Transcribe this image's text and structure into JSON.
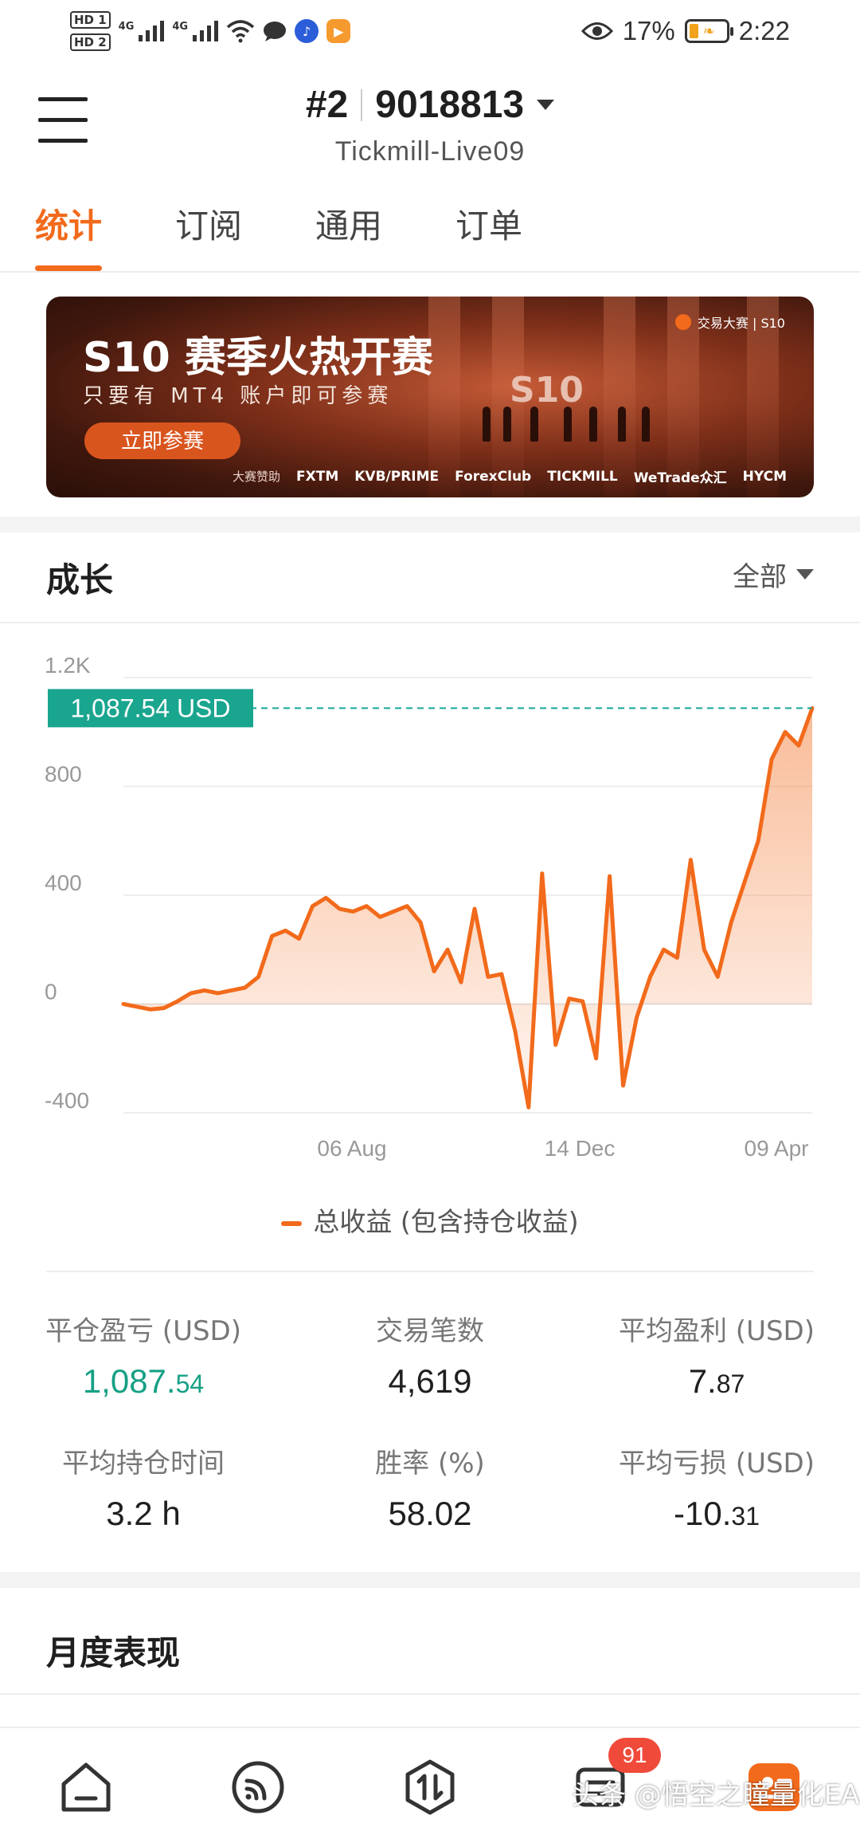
{
  "status_bar": {
    "hd1": "HD 1",
    "hd2": "HD 2",
    "net1": "4G",
    "net2": "4G",
    "battery_pct": "17%",
    "time": "2:22"
  },
  "header": {
    "account_number": "#2",
    "account_id": "9018813",
    "server": "Tickmill-Live09"
  },
  "tabs": [
    {
      "label": "统计",
      "active": true
    },
    {
      "label": "订阅",
      "active": false
    },
    {
      "label": "通用",
      "active": false
    },
    {
      "label": "订单",
      "active": false
    }
  ],
  "banner": {
    "title": "S10 赛季火热开赛",
    "subtitle": "只要有 MT4 账户即可参赛",
    "button": "立即参赛",
    "tag": "交易大赛 | S10",
    "emblem": "S10",
    "sponsor_lead": "大赛赞助",
    "sponsors": [
      "FXTM",
      "KVB/PRIME",
      "ForexClub",
      "TICKMILL",
      "WeTrade众汇",
      "HYCM"
    ]
  },
  "growth": {
    "title": "成长",
    "range": "全部"
  },
  "chart_data": {
    "type": "area",
    "ylim": [
      -400,
      1200
    ],
    "y_ticks": [
      "1.2K",
      "800",
      "400",
      "0",
      "-400"
    ],
    "x_tick_labels": [
      "06 Aug",
      "14 Dec",
      "09 Apr"
    ],
    "current_value_label": "1,087.54 USD",
    "current_value": 1087.54,
    "series": [
      {
        "name": "总收益 (包含持仓收益)",
        "color": "#f26a1b",
        "values": [
          0,
          -10,
          -20,
          -15,
          10,
          40,
          50,
          40,
          50,
          60,
          100,
          250,
          270,
          240,
          360,
          390,
          350,
          340,
          360,
          320,
          340,
          360,
          300,
          120,
          200,
          80,
          350,
          100,
          110,
          -100,
          -380,
          480,
          -150,
          20,
          10,
          -200,
          470,
          -300,
          -50,
          100,
          200,
          170,
          530,
          200,
          100,
          300,
          450,
          600,
          900,
          1000,
          950,
          1087.54
        ]
      }
    ],
    "legend": "总收益 (包含持仓收益)"
  },
  "stats": [
    {
      "label": "平仓盈亏 (USD)",
      "int": "1,087.",
      "dec": "54",
      "green": true
    },
    {
      "label": "交易笔数",
      "int": "4,619",
      "dec": "",
      "green": false
    },
    {
      "label": "平均盈利 (USD)",
      "int": "7.",
      "dec": "87",
      "green": false
    },
    {
      "label": "平均持仓时间",
      "int": "3.2 h",
      "dec": "",
      "green": false
    },
    {
      "label": "胜率 (%)",
      "int": "58.02",
      "dec": "",
      "green": false
    },
    {
      "label": "平均亏损 (USD)",
      "int": "-10.",
      "dec": "31",
      "green": false
    }
  ],
  "monthly": {
    "title": "月度表现"
  },
  "bottom_nav": {
    "badge_count": "91",
    "items": [
      "home-icon",
      "signal-icon",
      "trade-icon",
      "message-icon",
      "profile-icon"
    ]
  },
  "watermark": "头条 @悟空之瞳量化EA"
}
